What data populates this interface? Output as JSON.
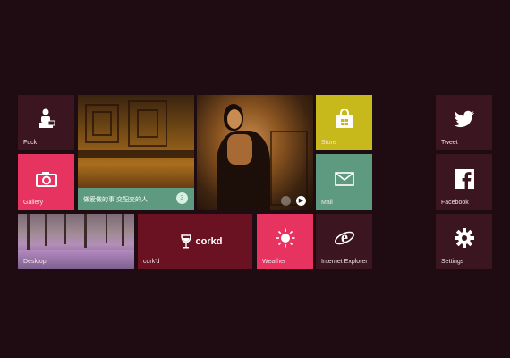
{
  "tiles": {
    "fuck": {
      "label": "Fuck",
      "icon": "person-chat-icon"
    },
    "gallery": {
      "label": "Gallery",
      "icon": "camera-icon"
    },
    "photo_caption": {
      "text": "做爱做的事 交配交的人",
      "badge": "3",
      "icon": "play-arrow-icon"
    },
    "store": {
      "label": "Store",
      "icon": "store-bag-icon"
    },
    "mail": {
      "label": "Mail",
      "icon": "envelope-icon"
    },
    "desktop": {
      "label": "Desktop"
    },
    "corkd": {
      "label": "cork'd",
      "logo_text": "corkd"
    },
    "weather": {
      "label": "Weather",
      "icon": "sun-icon"
    },
    "ie": {
      "label": "Internet Explorer",
      "icon": "ie-icon"
    },
    "tweet": {
      "label": "Tweet",
      "icon": "twitter-bird-icon"
    },
    "facebook": {
      "label": "Facebook",
      "icon": "facebook-icon"
    },
    "settings": {
      "label": "Settings",
      "icon": "gear-icon"
    }
  },
  "colors": {
    "background": "#1f0c13",
    "dark_tile": "#3b1520",
    "pink": "#e6335f",
    "olive": "#c7b81c",
    "teal": "#5e9a7f",
    "wine": "#6b1222"
  }
}
